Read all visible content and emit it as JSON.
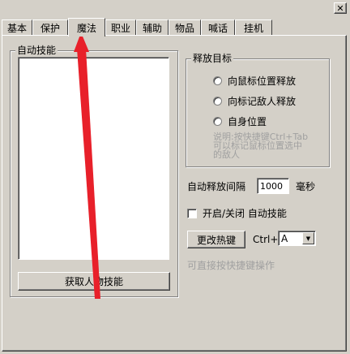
{
  "window": {
    "close_glyph": "✕"
  },
  "tabs": [
    {
      "label": "基本"
    },
    {
      "label": "保护"
    },
    {
      "label": "魔法",
      "active": true
    },
    {
      "label": "职业"
    },
    {
      "label": "辅助"
    },
    {
      "label": "物品"
    },
    {
      "label": "喊话"
    },
    {
      "label": "挂机"
    }
  ],
  "auto_skills": {
    "title": "自动技能",
    "get_skills_button": "获取人物技能"
  },
  "release_target": {
    "title": "释放目标",
    "options": [
      {
        "label": "向鼠标位置释放"
      },
      {
        "label": "向标记敌人释放"
      },
      {
        "label": "自身位置"
      }
    ],
    "note_lines": [
      "说明:按快捷键Ctrl+Tab",
      "可以标记鼠标位置选中",
      "的敌人"
    ]
  },
  "interval": {
    "label": "自动释放间隔",
    "value": "1000",
    "unit": "毫秒"
  },
  "toggle": {
    "label": "开启/关闭 自动技能"
  },
  "hotkey": {
    "button_label": "更改热键",
    "modifier_label": "Ctrl+",
    "key_value": "A",
    "hint": "可直接按快捷键操作"
  },
  "annotation": {
    "color": "#e8202a"
  }
}
